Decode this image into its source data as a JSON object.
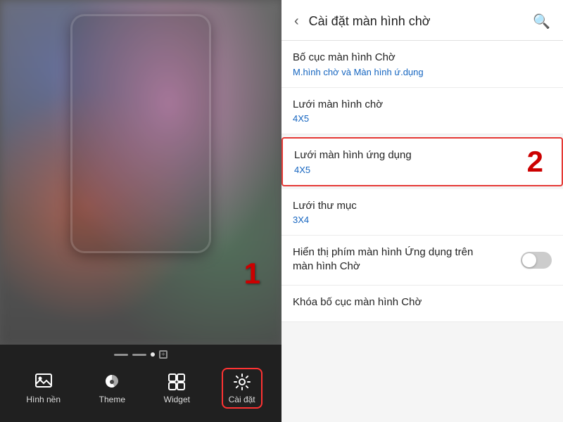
{
  "left": {
    "step_label": "1",
    "dock": {
      "indicators": [
        "dash",
        "dash",
        "dot-active",
        "plus"
      ],
      "items": [
        {
          "id": "hinh-nen",
          "label": "Hình nền",
          "icon": "wallpaper"
        },
        {
          "id": "theme",
          "label": "Theme",
          "icon": "theme"
        },
        {
          "id": "widget",
          "label": "Widget",
          "icon": "widget"
        },
        {
          "id": "cai-dat",
          "label": "Cài đặt",
          "icon": "settings",
          "active": true
        }
      ]
    }
  },
  "right": {
    "header": {
      "back_label": "<",
      "title": "Cài đặt màn hình chờ",
      "search_icon": "🔍"
    },
    "items": [
      {
        "id": "bo-cuc",
        "title": "Bố cục màn hình Chờ",
        "value": "M.hình chờ và Màn hình ứ.dụng",
        "type": "nav"
      },
      {
        "id": "luoi-man-hinh-cho",
        "title": "Lưới màn hình chờ",
        "value": "4X5",
        "type": "nav"
      },
      {
        "id": "luoi-man-hinh-ung-dung",
        "title": "Lưới màn hình ứng dụng",
        "value": "4X5",
        "type": "nav",
        "highlighted": true,
        "step": "2"
      },
      {
        "id": "luoi-thu-muc",
        "title": "Lưới thư mục",
        "value": "3X4",
        "type": "nav"
      },
      {
        "id": "hien-thi-phim",
        "title": "Hiển thị phím màn hình Ứng dụng trên màn hình Chờ",
        "value": null,
        "type": "toggle",
        "toggle_on": false
      },
      {
        "id": "khoa-bo-cuc",
        "title": "Khóa bố cục màn hình Chờ",
        "value": null,
        "type": "nav"
      }
    ]
  }
}
